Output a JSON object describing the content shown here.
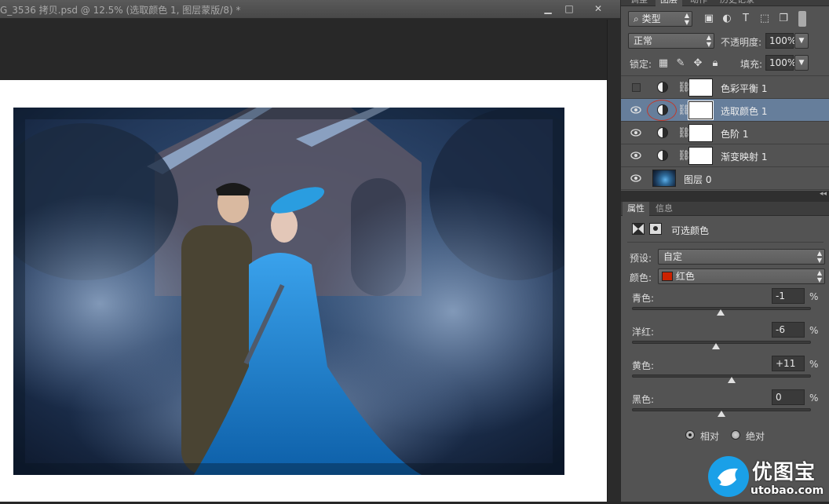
{
  "document": {
    "title": "G_3536 拷贝.psd @ 12.5% (选取颜色 1, 图层蒙版/8) *",
    "window_buttons": [
      "▁",
      "□",
      "✕"
    ]
  },
  "panel_tabs_top": [
    "调整",
    "图层",
    "动作",
    "历史记录"
  ],
  "layers_panel": {
    "filter_kind": "类型",
    "blend_mode": "正常",
    "opacity_label": "不透明度:",
    "opacity_value": "100%",
    "lock_label": "锁定:",
    "fill_label": "填充:",
    "fill_value": "100%",
    "layers": [
      {
        "name": "色彩平衡 1",
        "visible": false,
        "type": "adjustment",
        "selected": false
      },
      {
        "name": "选取颜色 1",
        "visible": true,
        "type": "adjustment",
        "selected": true
      },
      {
        "name": "色阶 1",
        "visible": true,
        "type": "adjustment",
        "selected": false
      },
      {
        "name": "渐变映射 1",
        "visible": true,
        "type": "adjustment",
        "selected": false
      },
      {
        "name": "图层 0",
        "visible": true,
        "type": "image",
        "selected": false
      }
    ]
  },
  "properties_panel": {
    "tabs": [
      "属性",
      "信息"
    ],
    "adjustment_title": "可选颜色",
    "preset_label": "预设:",
    "preset_value": "自定",
    "colors_label": "颜色:",
    "colors_value": "红色",
    "colors_swatch": "#cc2200",
    "sliders": [
      {
        "label": "青色:",
        "value": "-1",
        "unit": "%",
        "position": 0.495
      },
      {
        "label": "洋红:",
        "value": "-6",
        "unit": "%",
        "position": 0.47
      },
      {
        "label": "黄色:",
        "value": "+11",
        "unit": "%",
        "position": 0.555
      },
      {
        "label": "黑色:",
        "value": "0",
        "unit": "%",
        "position": 0.5
      }
    ],
    "method_options": [
      "相对",
      "绝对"
    ],
    "method_selected": "相对"
  },
  "watermark": {
    "brand": "优图宝",
    "url": "utobao.com"
  },
  "colors": {
    "panel_bg": "#535353",
    "selected_layer": "#667e9b",
    "app_bg": "#282828"
  }
}
